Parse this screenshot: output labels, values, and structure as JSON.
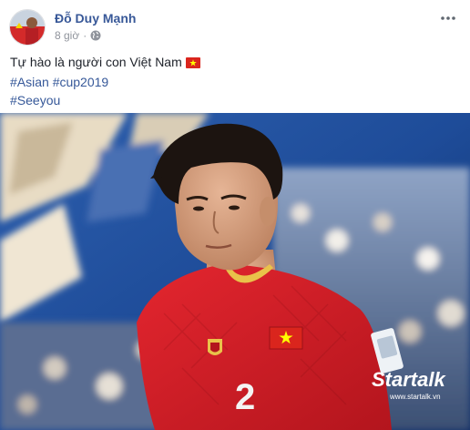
{
  "post": {
    "author": "Đỗ Duy Mạnh",
    "time": "8 giờ",
    "separator": "·",
    "privacy_icon": "globe-icon",
    "more_icon": "more-options-icon",
    "lines": [
      "Tự hào là người con Việt Nam",
      "#Asian #cup2019",
      "#Seeyou"
    ],
    "emoji": "flag-vietnam-icon"
  },
  "photo": {
    "shirt_number": "2",
    "watermark_brand": "Startalk",
    "watermark_url": "www.startalk.vn"
  },
  "colors": {
    "link": "#385898",
    "hashtag": "#365899",
    "meta": "#90949c",
    "jersey": "#d8202a",
    "flag_red": "#da251d",
    "flag_star": "#ffff00"
  }
}
